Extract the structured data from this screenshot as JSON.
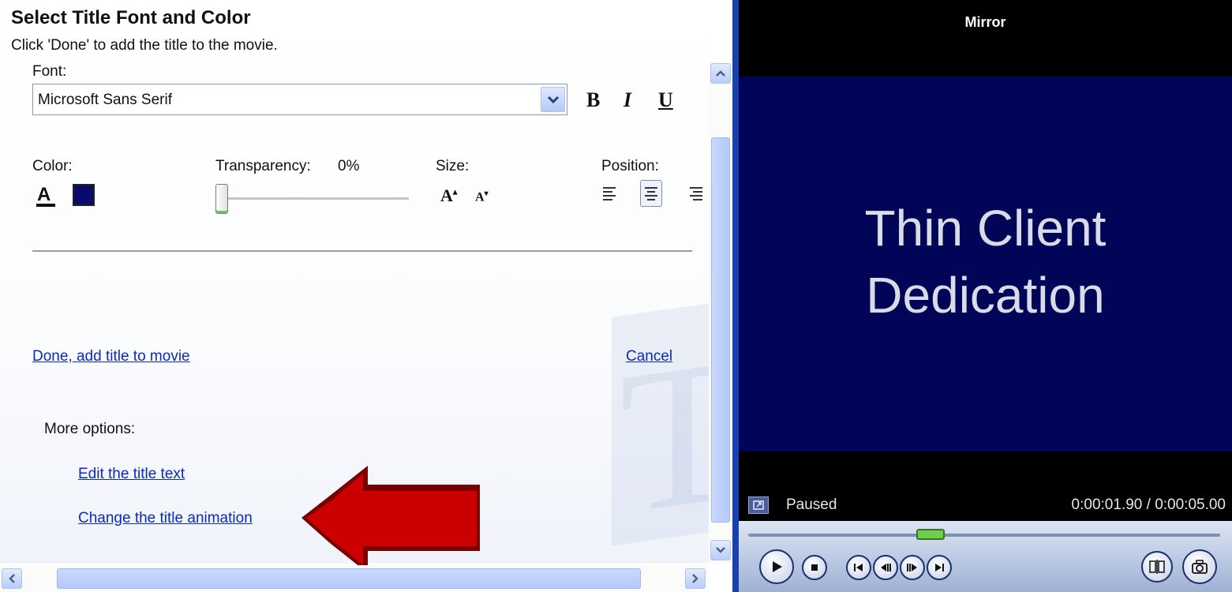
{
  "panel": {
    "title": "Select Title Font and Color",
    "subtitle": "Click 'Done' to add the title to the movie.",
    "font_label": "Font:",
    "font_value": "Microsoft Sans Serif",
    "bold_label": "B",
    "italic_label": "I",
    "underline_label": "U",
    "color_label": "Color:",
    "transparency_label": "Transparency:",
    "transparency_value": "0%",
    "size_label": "Size:",
    "position_label": "Position:",
    "done_link": "Done, add title to movie",
    "cancel_link": "Cancel",
    "more_options_label": "More options:",
    "edit_text_link": "Edit the title text",
    "change_animation_link": "Change the title animation",
    "color_swatch": "#0a0a6a",
    "arrow_color": "#cc0000"
  },
  "preview": {
    "window_title": "Mirror",
    "title_line1": "Thin Client",
    "title_line2": "Dedication",
    "status": "Paused",
    "time": "0:00:01.90 / 0:00:05.00",
    "seek_fraction": 0.38,
    "video_bg": "#000557"
  }
}
